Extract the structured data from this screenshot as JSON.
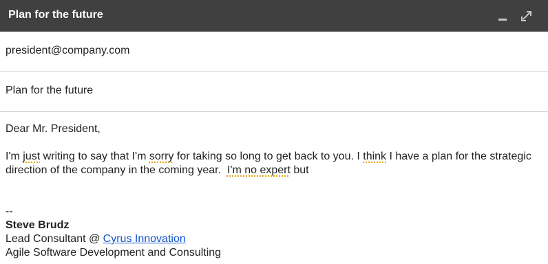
{
  "window": {
    "title": "Plan for the future",
    "minimize_icon": "minimize-icon",
    "expand_icon": "expand-icon"
  },
  "recipient": {
    "value": "president@company.com"
  },
  "subject": {
    "value": "Plan for the future"
  },
  "body": {
    "greeting": "Dear Mr. President,",
    "paragraph": {
      "seg1": "I'm ",
      "seg2": "just",
      "seg3": " writing to say that I'm ",
      "seg4": "sorry",
      "seg5": " for taking so long to get back to you. I ",
      "seg6": "think",
      "seg7": " I have a plan for the strategic direction of the company in the coming year.  ",
      "seg8": "I'm no expert",
      "seg9": " but"
    }
  },
  "signature": {
    "separator": "--",
    "name": "Steve Brudz",
    "role_prefix": "Lead Consultant @ ",
    "company_link": "Cyrus Innovation",
    "tagline": "Agile Software Development and Consulting"
  },
  "colors": {
    "titlebar_bg": "#404040",
    "link": "#1155cc",
    "spellcheck_underline": "#e8a600"
  }
}
